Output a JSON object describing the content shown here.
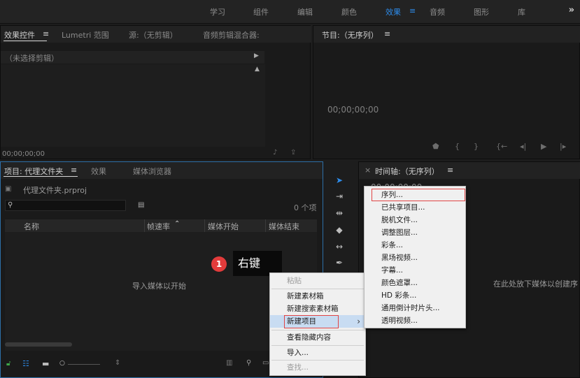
{
  "workspace_tabs": [
    "学习",
    "组件",
    "编辑",
    "颜色",
    "效果",
    "音频",
    "图形",
    "库"
  ],
  "workspace_active": "效果",
  "workspace_menu_glyph": "≡",
  "workspace_overflow": "»",
  "effect_controls": {
    "tabs": [
      "效果控件",
      "Lumetri 范围",
      "源:（无剪辑）",
      "音频剪辑混合器:"
    ],
    "no_clip": "（未选择剪辑）",
    "timecode": "00;00;00;00"
  },
  "program": {
    "title": "节目:（无序列）",
    "timecode": "00;00;00;00"
  },
  "project": {
    "tabs": [
      "项目: 代理文件夹",
      "效果",
      "媒体浏览器"
    ],
    "file_name": "代理文件夹.prproj",
    "item_count": "0 个项",
    "columns": [
      "名称",
      "帧速率",
      "媒体开始",
      "媒体结束"
    ],
    "empty_hint": "导入媒体以开始"
  },
  "timeline": {
    "title": "时间轴:（无序列）",
    "timecode": "00;00;00;00",
    "drop_hint": "在此处放下媒体以创建序"
  },
  "annotation": {
    "number": "1",
    "label": "右键"
  },
  "context_menu": {
    "items": [
      "粘贴",
      "新建素材箱",
      "新建搜索素材箱",
      "新建项目",
      "查看隐藏内容",
      "导入...",
      "查找..."
    ],
    "submenu_arrow": "›"
  },
  "submenu": {
    "items": [
      "序列...",
      "已共享项目...",
      "脱机文件...",
      "调整图层...",
      "彩条...",
      "黑场视频...",
      "字幕...",
      "颜色遮罩...",
      "HD 彩条...",
      "通用倒计时片头...",
      "透明视频..."
    ]
  },
  "colors": {
    "accent": "#2d8ceb",
    "highlight_box": "#e04444",
    "badge": "#e23b3b"
  }
}
